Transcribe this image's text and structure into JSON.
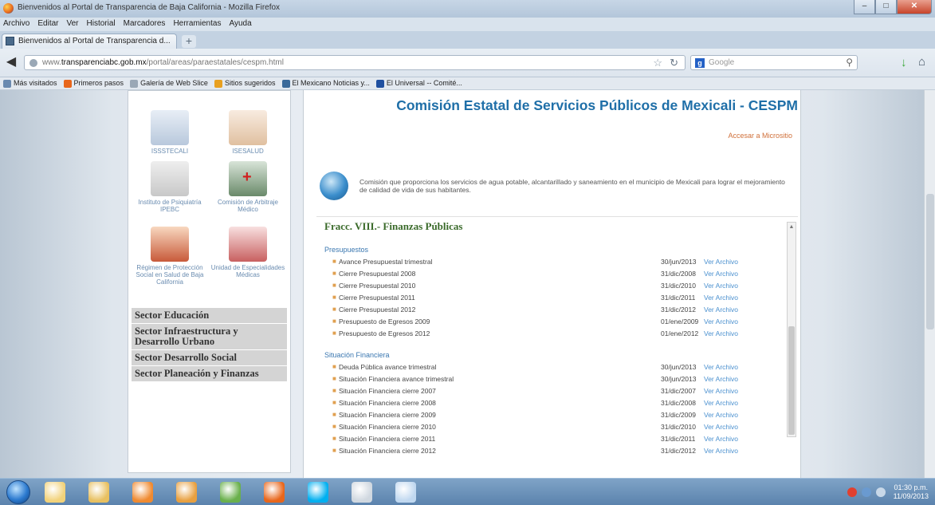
{
  "window": {
    "title": "Bienvenidos al Portal de Transparencia de Baja California - Mozilla Firefox",
    "buttons": {
      "minimize": "–",
      "maximize": "□",
      "close": "✕"
    }
  },
  "menu": [
    "Archivo",
    "Editar",
    "Ver",
    "Historial",
    "Marcadores",
    "Herramientas",
    "Ayuda"
  ],
  "tab": {
    "label": "Bienvenidos al Portal de Transparencia d...",
    "new_tab": "+"
  },
  "nav": {
    "url_prefix": "www.",
    "url_domain": "transparenciabc.gob.mx",
    "url_path": "/portal/areas/paraestatales/cespm.html",
    "search_placeholder": "Google"
  },
  "bookmarks": [
    {
      "label": "Más visitados",
      "color": "#6a8ab0"
    },
    {
      "label": "Primeros pasos",
      "color": "#e8661b"
    },
    {
      "label": "Galería de Web Slice",
      "color": "#9aa8b6"
    },
    {
      "label": "Sitios sugeridos",
      "color": "#e8a020"
    },
    {
      "label": "El Mexicano Noticias y...",
      "color": "#3a6a9a"
    },
    {
      "label": "El Universal -- Comité...",
      "color": "#2050a0"
    }
  ],
  "sidebar": {
    "agencies": [
      {
        "label": "ISSSTECALI",
        "color": "#d8e4f0"
      },
      {
        "label": "ISESALUD",
        "color": "#f0e0d0"
      },
      {
        "label": "Instituto de Psiquiatría IPEBC",
        "color": "#e4e4e4"
      },
      {
        "label": "Comisión de Arbitraje Médico",
        "color": "#c8d8c8"
      },
      {
        "label": "Régimen de Protección Social en Salud de Baja California",
        "color": "#f4d8c8"
      },
      {
        "label": "Unidad de Especialidades Médicas",
        "color": "#f0d0d0"
      }
    ],
    "sectors": [
      "Sector Educación",
      "Sector Infraestructura y Desarrollo Urbano",
      "Sector Desarrollo Social",
      "Sector Planeación y Finanzas"
    ]
  },
  "main": {
    "title": "Comisión Estatal de Servicios Públicos de Mexicali - CESPM",
    "login_link": "Accesar a Micrositio",
    "description": "Comisión que proporciona los servicios de agua potable, alcantarillado y saneamiento en el municipio de Mexicali para lograr el mejoramiento de calidad de vida de sus habitantes.",
    "section": "Fracc. VIII.- Finanzas Públicas",
    "groups": [
      {
        "title": "Presupuestos",
        "rows": [
          {
            "doc": "Avance Presupuestal trimestral",
            "date": "30/jun/2013",
            "link": "Ver Archivo"
          },
          {
            "doc": "Cierre Presupuestal 2008",
            "date": "31/dic/2008",
            "link": "Ver Archivo"
          },
          {
            "doc": "Cierre Presupuestal 2010",
            "date": "31/dic/2010",
            "link": "Ver Archivo"
          },
          {
            "doc": "Cierre Presupuestal 2011",
            "date": "31/dic/2011",
            "link": "Ver Archivo"
          },
          {
            "doc": "Cierre Presupuestal 2012",
            "date": "31/dic/2012",
            "link": "Ver Archivo"
          },
          {
            "doc": "Presupuesto de Egresos 2009",
            "date": "01/ene/2009",
            "link": "Ver Archivo"
          },
          {
            "doc": "Presupuesto de Egresos 2012",
            "date": "01/ene/2012",
            "link": "Ver Archivo"
          }
        ]
      },
      {
        "title": "Situación Financiera",
        "rows": [
          {
            "doc": "Deuda Pública avance trimestral",
            "date": "30/jun/2013",
            "link": "Ver Archivo"
          },
          {
            "doc": "Situación Financiera avance trimestral",
            "date": "30/jun/2013",
            "link": "Ver Archivo"
          },
          {
            "doc": "Situación Financiera cierre 2007",
            "date": "31/dic/2007",
            "link": "Ver Archivo"
          },
          {
            "doc": "Situación Financiera cierre 2008",
            "date": "31/dic/2008",
            "link": "Ver Archivo"
          },
          {
            "doc": "Situación Financiera cierre 2009",
            "date": "31/dic/2009",
            "link": "Ver Archivo"
          },
          {
            "doc": "Situación Financiera cierre 2010",
            "date": "31/dic/2010",
            "link": "Ver Archivo"
          },
          {
            "doc": "Situación Financiera cierre 2011",
            "date": "31/dic/2011",
            "link": "Ver Archivo"
          },
          {
            "doc": "Situación Financiera cierre 2012",
            "date": "31/dic/2012",
            "link": "Ver Archivo"
          }
        ]
      }
    ]
  },
  "taskbar": {
    "apps": [
      {
        "name": "explorer",
        "color": "#f2d27a"
      },
      {
        "name": "folder",
        "color": "#e8c060"
      },
      {
        "name": "media-player",
        "color": "#f08a30"
      },
      {
        "name": "paint",
        "color": "#e8a040"
      },
      {
        "name": "chrome",
        "color": "#6ab04c"
      },
      {
        "name": "firefox",
        "color": "#e8661b"
      },
      {
        "name": "skype",
        "color": "#00aff0"
      },
      {
        "name": "calculator",
        "color": "#d0d8e0"
      },
      {
        "name": "notepad",
        "color": "#c0d8f0"
      }
    ],
    "clock_time": "01:30 p.m.",
    "clock_date": "11/09/2013"
  }
}
